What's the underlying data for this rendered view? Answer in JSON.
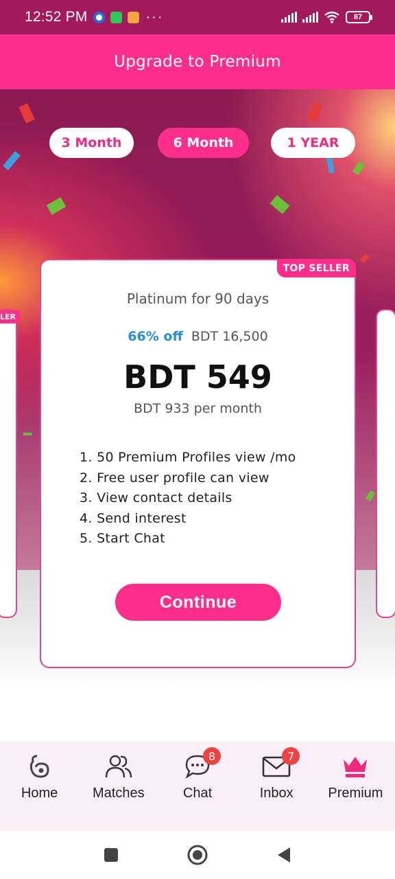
{
  "status_bar": {
    "time": "12:52 PM",
    "battery": "87",
    "dots": "···"
  },
  "header": {
    "title": "Upgrade to Premium"
  },
  "tabs": [
    {
      "label": "3 Month",
      "active": false
    },
    {
      "label": "6 Month",
      "active": true
    },
    {
      "label": "1 YEAR",
      "active": false
    }
  ],
  "card": {
    "badge": "TOP SELLER",
    "side_badge": "LER",
    "plan_name": "Platinum for 90 days",
    "discount": "66% off",
    "original_price": "BDT 16,500",
    "price": "BDT 549",
    "per_month": "BDT 933 per month",
    "features": [
      "1. 50 Premium Profiles view /mo",
      "2. Free user profile can view",
      "3. View contact details",
      "4. Send interest",
      "5. Start Chat"
    ],
    "continue_label": "Continue"
  },
  "bottom_nav": [
    {
      "label": "Home",
      "icon": "home-logo-icon"
    },
    {
      "label": "Matches",
      "icon": "users-icon"
    },
    {
      "label": "Chat",
      "icon": "chat-icon",
      "badge": "8"
    },
    {
      "label": "Inbox",
      "icon": "mail-icon",
      "badge": "7"
    },
    {
      "label": "Premium",
      "icon": "crown-icon",
      "active": true
    }
  ],
  "colors": {
    "primary": "#fe2f8c",
    "status_bar": "#a31a5c",
    "discount": "#2a8fd1",
    "badge": "#ef4343"
  }
}
